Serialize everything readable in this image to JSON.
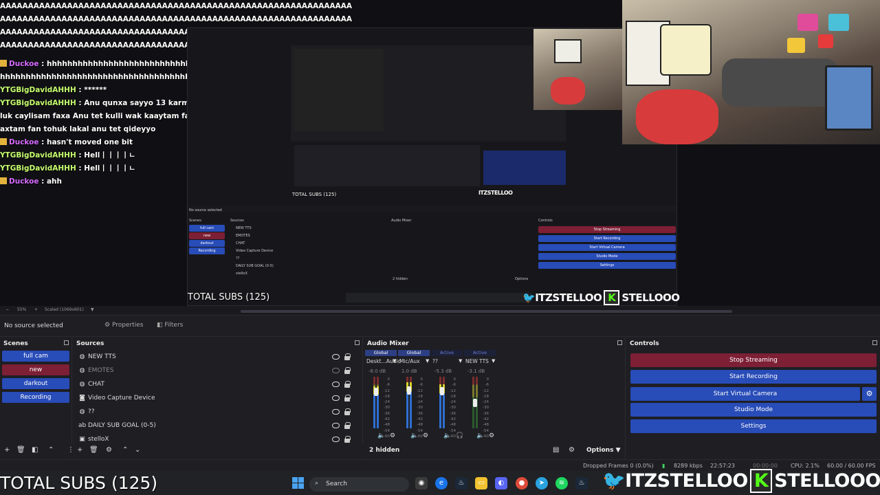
{
  "chat": {
    "spam_text": "AAAAAAAAAAAAAAAAAAAAAAAAAAAAAAAAAAAAAAAAAAAAAAAAAAAAAAAAAAAAAAAAAAAAAAAAAAAAAAAAAAAAAAAAAAAAAAAAAAAAAAAAAAAAAAAAAAAAAAAAAAAAAAAAAAAAAAAAAAAAAAAAAAAAAAAAAAAAAAAAAAAAAAAAAAAAAAAAAAAAAAAAAAAAAAAAAAAAAAAAAAAAAAAAAAAAAAAAAAAAAAAAAAAAAAAAAAAAAAAAAAA",
    "messages": [
      {
        "user": "Duckoe",
        "text": "hhhhhhhhhhhhhhhhhhhhhhhhhhhhhhhhhhhhhhhhhhhhhhhhhhhhhhhhhhhhhhhhhhhhhhhhhhhhhhhhhhhhhhhhhhhhhhhhhhhhhhhhhhhhhhhh hhhhh",
        "badge": true
      },
      {
        "user": "YTGBigDavidAHHH",
        "text": "******",
        "badge": false
      },
      {
        "user": "YTGBigDavidAHHH",
        "text": "Anu qunxa sayyo 13 karmak gubal tan yi kaxxa Guthy 24 inch dick luk caylisam faxa Anu tet kulli wak kaaytam faxa anu tet cuisam fan tet asshole qabli caxtam fan tohuk lakal anu tet qideyyo",
        "badge": false
      },
      {
        "user": "Duckoe",
        "text": "hasn't moved one bit",
        "badge": true
      },
      {
        "user": "YTGBigDavidAHHH",
        "text": "Hell丨丨丨丨ㄴ",
        "badge": false
      },
      {
        "user": "YTGBigDavidAHHH",
        "text": "Hell丨丨丨丨ㄴ",
        "badge": false
      },
      {
        "user": "Duckoe",
        "text": "ahh",
        "badge": true
      }
    ]
  },
  "overlay": {
    "total_subs": "TOTAL SUBS (125)",
    "handle1": "ITZSTELLOO",
    "handle2": "STELLOOO",
    "handle_letter": "K"
  },
  "preview_toolbar": {
    "zoom": "55%",
    "scale": "Scaled (1069x601)"
  },
  "properties_bar": {
    "no_source": "No source selected",
    "properties": "Properties",
    "filters": "Filters"
  },
  "scenes": {
    "title": "Scenes",
    "items": [
      {
        "label": "full cam",
        "active": false
      },
      {
        "label": "new",
        "active": true
      },
      {
        "label": "darkout",
        "active": false
      },
      {
        "label": "Recording",
        "active": false
      }
    ]
  },
  "sources": {
    "title": "Sources",
    "items": [
      {
        "label": "NEW TTS",
        "icon": "globe-icon",
        "visible": true,
        "dim": false
      },
      {
        "label": "EMOTES",
        "icon": "globe-icon",
        "visible": false,
        "dim": true
      },
      {
        "label": "CHAT",
        "icon": "globe-icon",
        "visible": true,
        "dim": false
      },
      {
        "label": "Video Capture Device",
        "icon": "camera-icon",
        "visible": true,
        "dim": false
      },
      {
        "label": "??",
        "icon": "globe-icon",
        "visible": true,
        "dim": false
      },
      {
        "label": "DAILY SUB GOAL (0-5)",
        "icon": "text-icon",
        "visible": true,
        "dim": false
      },
      {
        "label": "stelloX",
        "icon": "image-icon",
        "visible": true,
        "dim": false
      }
    ]
  },
  "mixer": {
    "title": "Audio Mixer",
    "channels": [
      {
        "header": "Global",
        "header_dim": false,
        "name": "Deskt...Audio",
        "db": "-8.0 dB",
        "fill": 0.82,
        "monitor": "normal"
      },
      {
        "header": "Global",
        "header_dim": false,
        "name": "Mic/Aux",
        "db": "1.0 dB",
        "fill": 0.9,
        "monitor": "normal"
      },
      {
        "header": "Active",
        "header_dim": true,
        "name": "??",
        "db": "-5.3 dB",
        "fill": 0.85,
        "monitor": "green"
      },
      {
        "header": "Active",
        "header_dim": true,
        "name": "NEW TTS",
        "db": "-3.1 dB",
        "fill": 0.0,
        "monitor": "red"
      }
    ],
    "scale": [
      "0",
      "-6",
      "-12",
      "-18",
      "-24",
      "-30",
      "-36",
      "-42",
      "-48",
      "-54",
      "-60"
    ],
    "hidden": "2 hidden",
    "options": "Options"
  },
  "controls": {
    "title": "Controls",
    "stop_streaming": "Stop Streaming",
    "start_recording": "Start Recording",
    "start_virtual_camera": "Start Virtual Camera",
    "studio_mode": "Studio Mode",
    "settings": "Settings"
  },
  "status": {
    "dropped": "Dropped Frames 0 (0.0%)",
    "kbps": "8289 kbps",
    "time": "22:57:23",
    "rec": "00:00:00",
    "cpu": "CPU: 2.1%",
    "fps": "60.00 / 60.00 FPS"
  },
  "taskbar": {
    "search": "Search"
  },
  "colors": {
    "accent_blue": "#284cb8",
    "active_red": "#7d1f35",
    "duck_name": "#d56bff",
    "ytg_name": "#c7ff6f"
  }
}
